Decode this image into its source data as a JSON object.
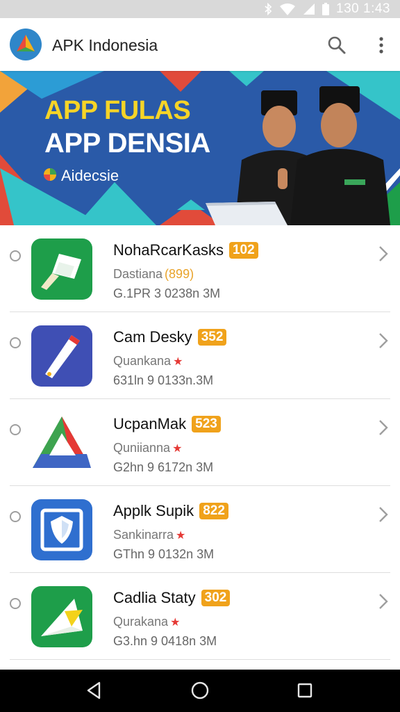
{
  "status_bar": {
    "time": "130 1:43",
    "icons": [
      "bluetooth-icon",
      "wifi-icon",
      "signal-icon",
      "battery-icon"
    ]
  },
  "header": {
    "title": "APK Indonesia",
    "logo": "app-logo-icon",
    "actions": [
      "search-icon",
      "more-vert-icon"
    ]
  },
  "banner": {
    "line1": "APP FULAS",
    "line2": "APP DENSIA",
    "brand": "Aidecsie"
  },
  "apps": [
    {
      "name": "NohaRcarKasks",
      "badge": "102",
      "sub": "Dastiana",
      "sub_extra": "(899)",
      "star": "",
      "meta": "G.1PR 3 0238n 3M",
      "icon": "green-flag-icon"
    },
    {
      "name": "Cam Desky",
      "badge": "352",
      "sub": "Quankana",
      "sub_extra": "",
      "star": "★",
      "meta": "631ln 9 0133n.3M",
      "icon": "blue-ruler-icon"
    },
    {
      "name": "UcpanMak",
      "badge": "523",
      "sub": "Quniianna",
      "sub_extra": "",
      "star": "★",
      "meta": "G2hn 9 6172n 3M",
      "icon": "triangle-logo-icon"
    },
    {
      "name": "Applk Supik",
      "badge": "822",
      "sub": "Sankinarra",
      "sub_extra": "",
      "star": "★",
      "meta": "GThn 9 0132n 3M",
      "icon": "shield-icon"
    },
    {
      "name": "Cadlia Staty",
      "badge": "302",
      "sub": "Qurakana",
      "sub_extra": "",
      "star": "★",
      "meta": "G3.hn 9 0418n 3M",
      "icon": "paper-plane-icon"
    }
  ],
  "nav": [
    "back-icon",
    "home-icon",
    "recents-icon"
  ],
  "colors": {
    "banner_blue": "#2a5aa8",
    "banner_cyan": "#34c3c8",
    "badge": "#f0a21b",
    "accent_red": "#e53935",
    "green": "#1e9e4a"
  }
}
